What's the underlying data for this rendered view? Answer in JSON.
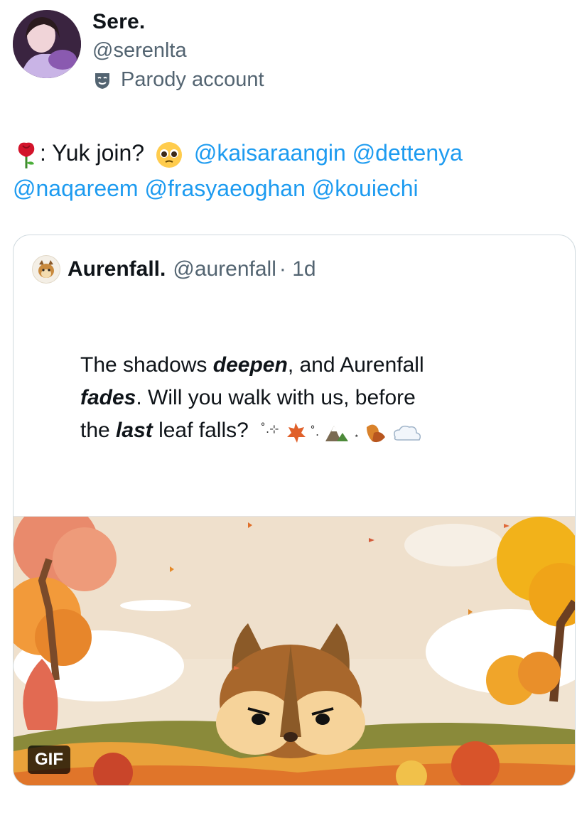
{
  "user": {
    "display_name": "Sere.",
    "handle": "@serenlta",
    "parody_label": "Parody account",
    "avatar_icon": "profile-photo",
    "parody_icon": "mask-icon"
  },
  "tweet": {
    "prefix": ": Yuk join?",
    "mentions": [
      "@kaisaraangin",
      "@dettenya",
      "@naqareem",
      "@frasyaeoghan",
      "@kouiechi"
    ],
    "mention_color": "#1d9bf0"
  },
  "quote": {
    "name": "Aurenfall.",
    "handle": "@aurenfall",
    "time": "· 1d",
    "text": {
      "l1a": "The shadows ",
      "l1b": "deepen",
      "l1c": ", and Aurenfall",
      "l2a": "fades",
      "l2b": ".   Will you walk with us, before",
      "l3a": "the ",
      "l3b": "last",
      "l3c": " leaf falls?"
    },
    "gif_label": "GIF"
  }
}
